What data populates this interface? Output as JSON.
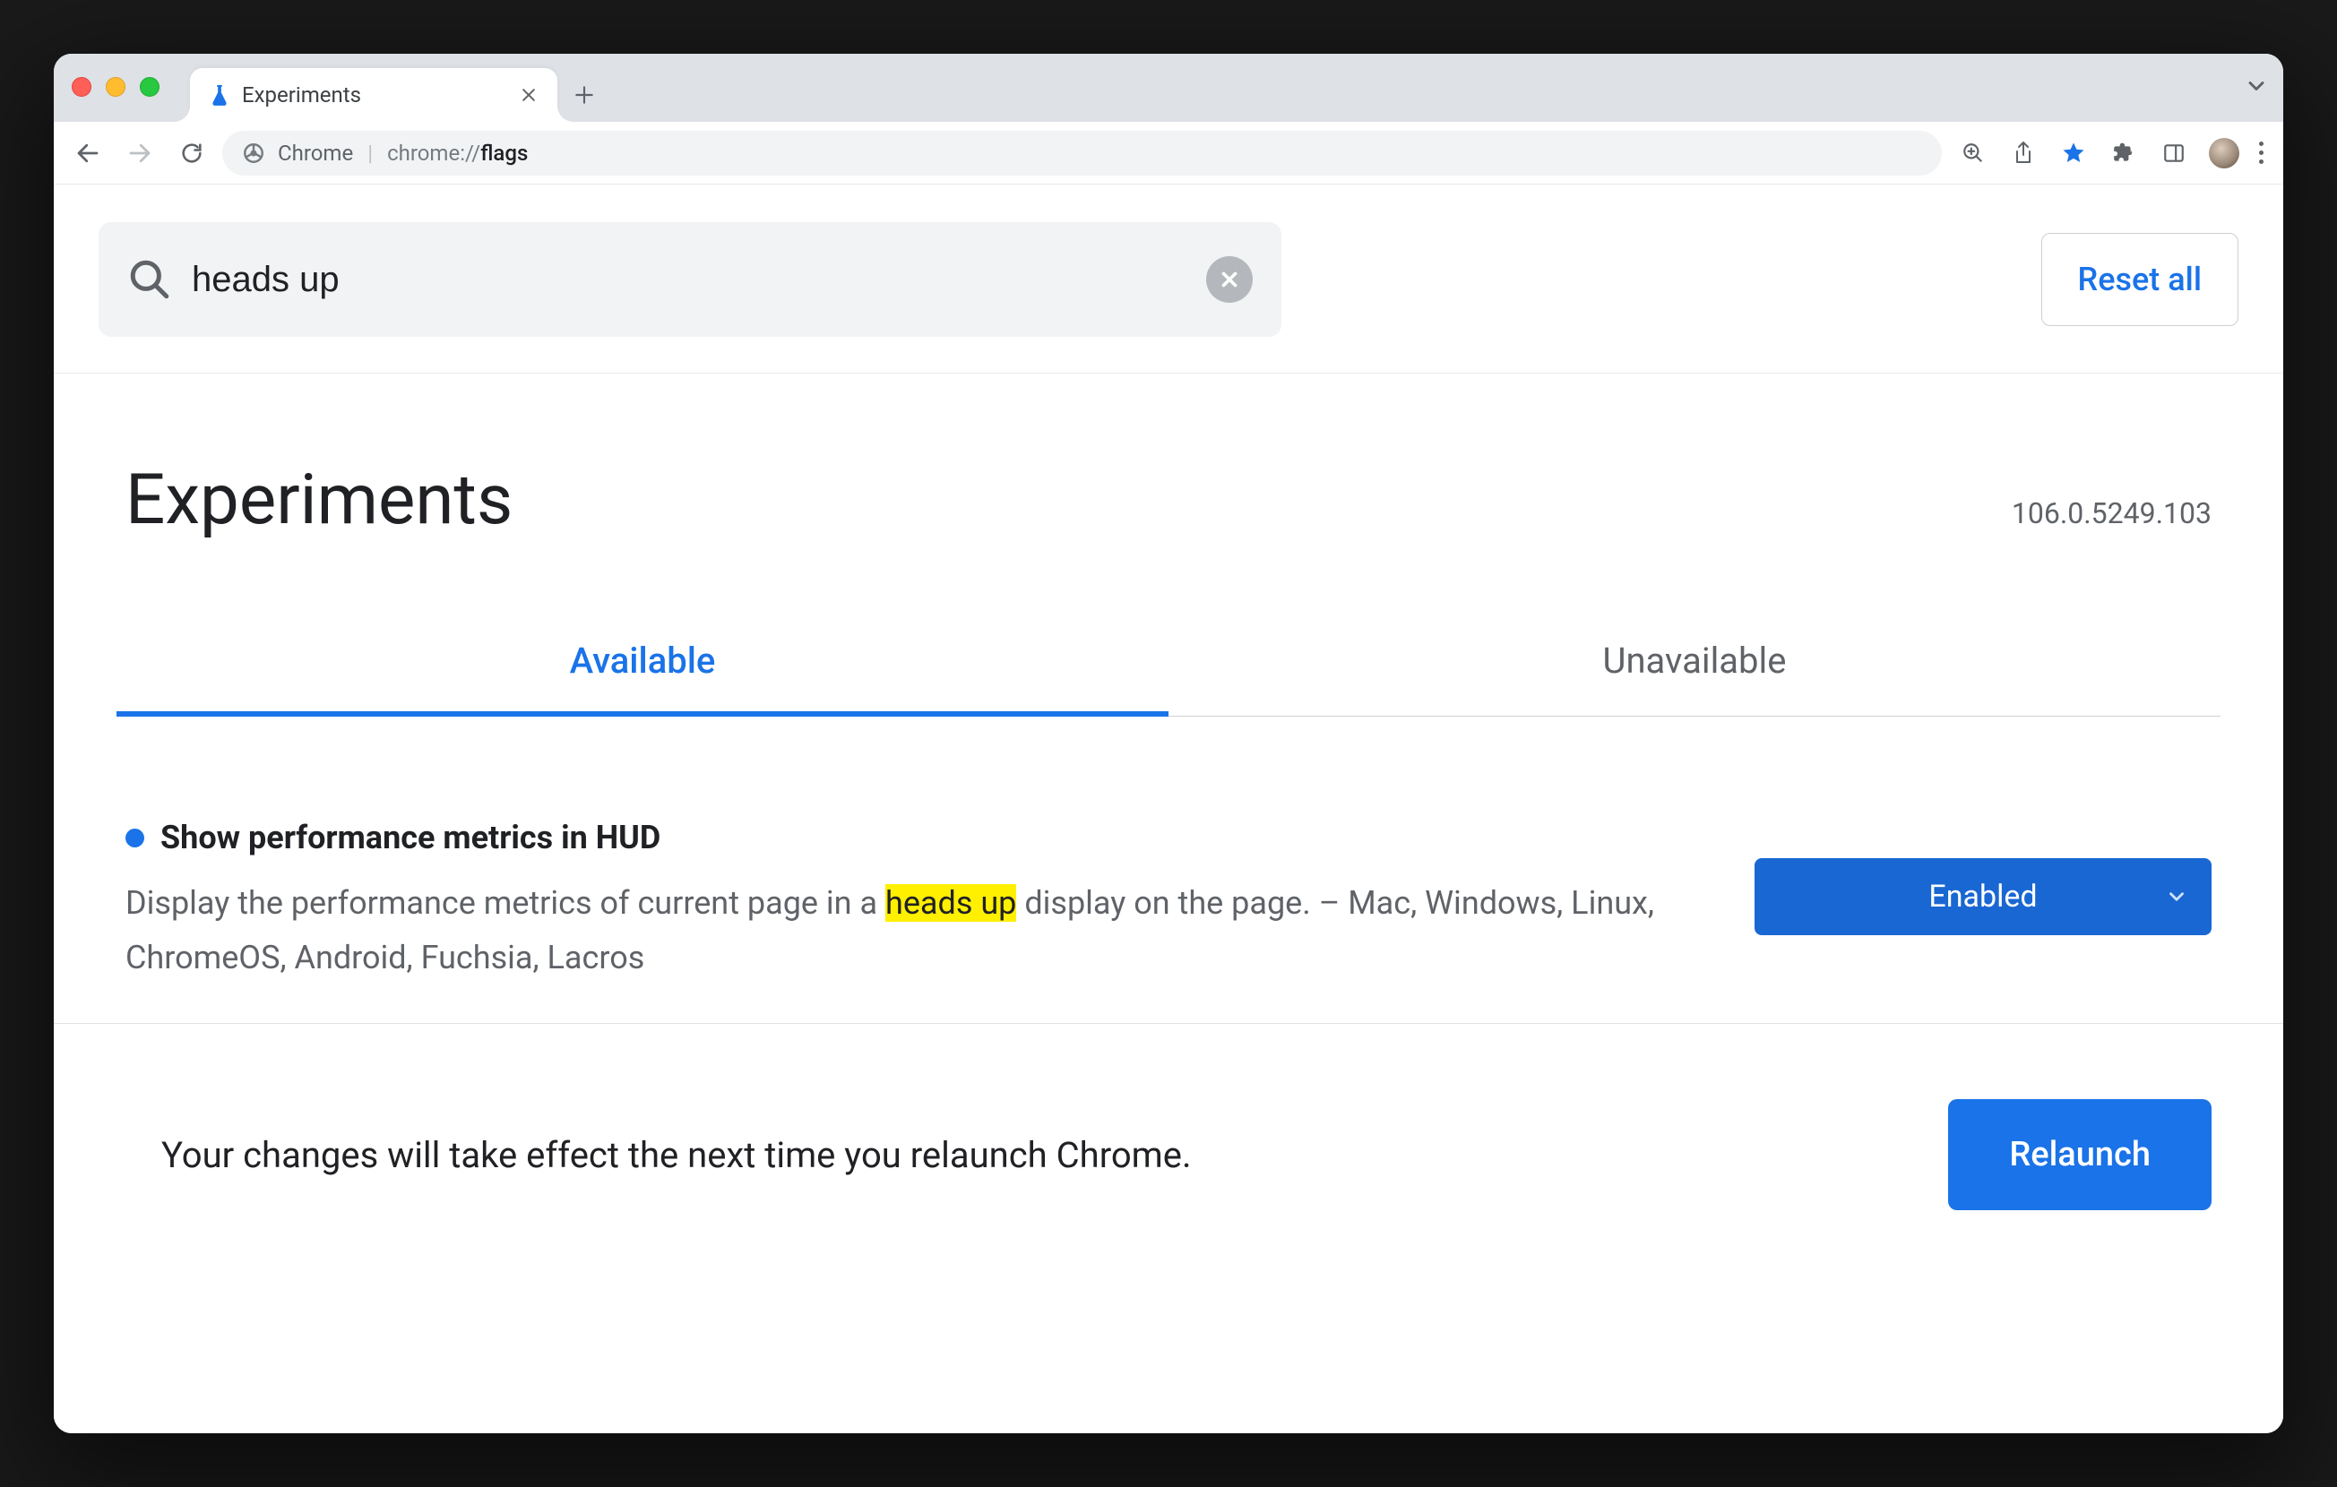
{
  "browser": {
    "tab_title": "Experiments",
    "omnibox_label": "Chrome",
    "url_scheme": "chrome://",
    "url_path": "flags"
  },
  "search": {
    "value": "heads up",
    "reset_label": "Reset all"
  },
  "header": {
    "title": "Experiments",
    "version": "106.0.5249.103"
  },
  "tabs": {
    "available": "Available",
    "unavailable": "Unavailable"
  },
  "flag": {
    "title": "Show performance metrics in HUD",
    "desc_pre": "Display the performance metrics of current page in a ",
    "desc_highlight": "heads up",
    "desc_post": " display on the page. – Mac, Windows, Linux, ChromeOS, Android, Fuchsia, Lacros",
    "select_value": "Enabled"
  },
  "footer": {
    "message": "Your changes will take effect the next time you relaunch Chrome.",
    "relaunch_label": "Relaunch"
  }
}
